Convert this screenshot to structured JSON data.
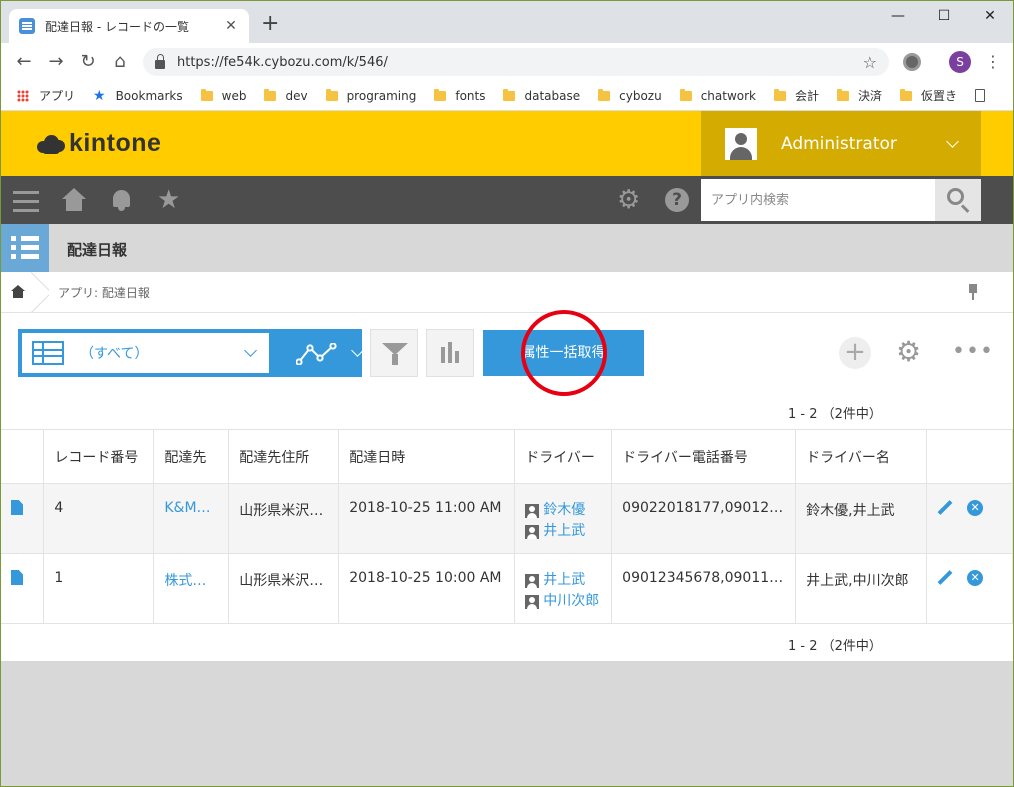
{
  "browser": {
    "tab_title": "配達日報 - レコードの一覧",
    "url": "https://fe54k.cybozu.com/k/546/",
    "profile_initial": "S",
    "bookmarks": [
      "アプリ",
      "Bookmarks",
      "web",
      "dev",
      "programing",
      "fonts",
      "database",
      "cybozu",
      "chatwork",
      "会計",
      "決済",
      "仮置き"
    ]
  },
  "header": {
    "logo_text": "kintone",
    "user_name": "Administrator"
  },
  "nav": {
    "search_placeholder": "アプリ内検索"
  },
  "app": {
    "title": "配達日報",
    "breadcrumb": "アプリ: 配達日報"
  },
  "toolbar": {
    "view_label": "（すべて）",
    "primary_button": "属性一括取得"
  },
  "pager": "1 - 2 （2件中）",
  "table": {
    "columns": [
      "レコード番号",
      "配達先",
      "配達先住所",
      "配達日時",
      "ドライバー",
      "ドライバー電話番号",
      "ドライバー名"
    ],
    "rows": [
      {
        "id": "4",
        "destination": "K&M…",
        "address": "山形県米沢…",
        "datetime": "2018-10-25 11:00 AM",
        "drivers": [
          "鈴木優",
          "井上武"
        ],
        "phone": "09022018177,09012…",
        "driver_names": "鈴木優,井上武"
      },
      {
        "id": "1",
        "destination": "株式…",
        "address": "山形県米沢…",
        "datetime": "2018-10-25 10:00 AM",
        "drivers": [
          "井上武",
          "中川次郎"
        ],
        "phone": "09012345678,09011…",
        "driver_names": "井上武,中川次郎"
      }
    ]
  }
}
